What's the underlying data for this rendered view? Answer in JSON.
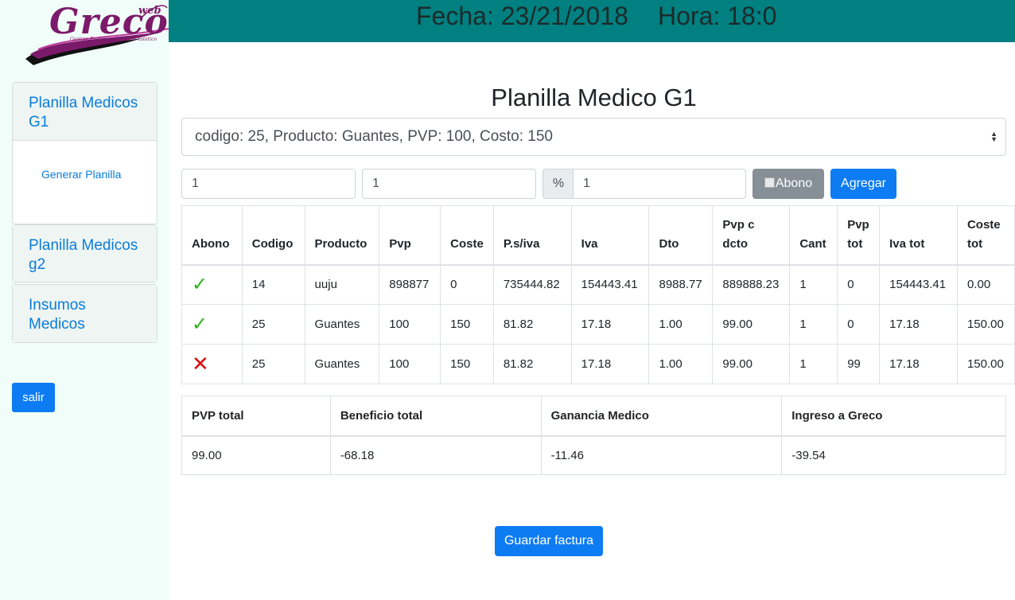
{
  "logo": {
    "text": "Greco",
    "super": "web",
    "tagline": "Gestion Profesional medico estetico"
  },
  "header": {
    "fecha": "Fecha: 23/21/2018",
    "hora": "Hora: 18:0"
  },
  "sidebar": {
    "cards": [
      {
        "title": "Planilla Medicos G1",
        "links": [
          "Generar Planilla"
        ]
      },
      {
        "title": "Planilla Medicos g2"
      },
      {
        "title": "Insumos Medicos"
      }
    ],
    "salir": "salir"
  },
  "main": {
    "title": "Planilla Medico G1",
    "product_select": "codigo: 25, Producto: Guantes, PVP: 100, Costo: 150",
    "input1": "1",
    "input2": "1",
    "pct_symbol": "%",
    "input3": "1",
    "abono_label": "Abono",
    "agregar_label": "Agregar",
    "guardar_label": "Guardar factura"
  },
  "items_table": {
    "headers": [
      "Abono",
      "Codigo",
      "Producto",
      "Pvp",
      "Coste",
      "P.s/iva",
      "Iva",
      "Dto",
      "Pvp c dcto",
      "Cant",
      "Pvp tot",
      "Iva tot",
      "Coste tot"
    ],
    "rows": [
      {
        "abono": "✓",
        "cells": [
          "14",
          "uuju",
          "898877",
          "0",
          "735444.82",
          "154443.41",
          "8988.77",
          "889888.23",
          "1",
          "0",
          "154443.41",
          "0.00"
        ]
      },
      {
        "abono": "✓",
        "cells": [
          "25",
          "Guantes",
          "100",
          "150",
          "81.82",
          "17.18",
          "1.00",
          "99.00",
          "1",
          "0",
          "17.18",
          "150.00"
        ]
      },
      {
        "abono": "✕",
        "cells": [
          "25",
          "Guantes",
          "100",
          "150",
          "81.82",
          "17.18",
          "1.00",
          "99.00",
          "1",
          "99",
          "17.18",
          "150.00"
        ]
      }
    ]
  },
  "totals_table": {
    "headers": [
      "PVP total",
      "Beneficio total",
      "Ganancia Medico",
      "Ingreso a Greco"
    ],
    "values": [
      "99.00",
      "-68.18",
      "-11.46",
      "-39.54"
    ]
  },
  "colors": {
    "topbar": "#008080",
    "primary": "#0d7cf3",
    "sidebar_bg": "#f1fdf8",
    "check": "#2bb51b",
    "cross": "#d90e0e"
  }
}
